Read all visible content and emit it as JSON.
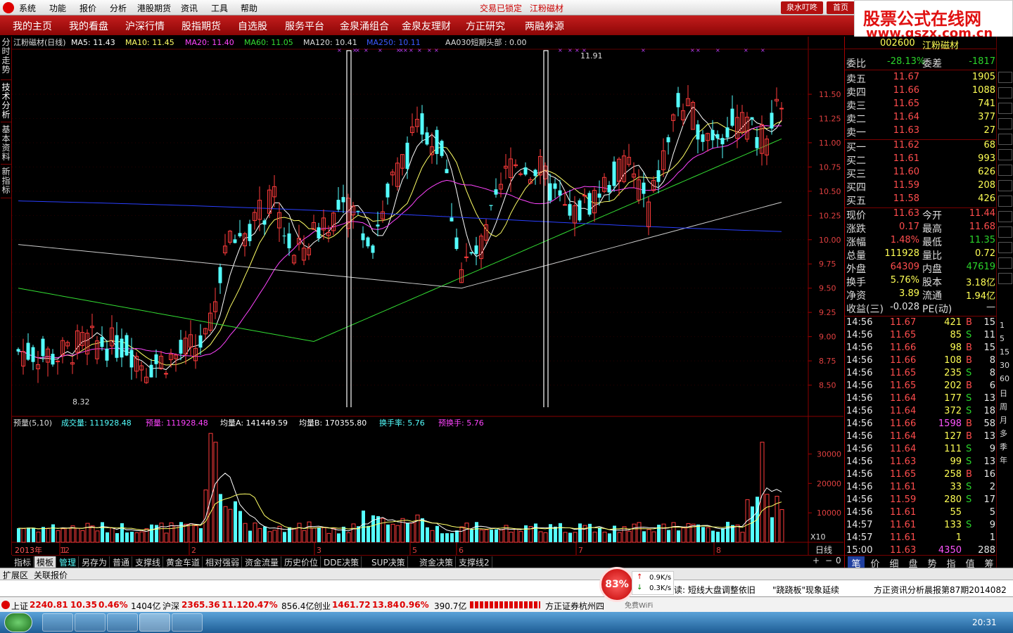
{
  "titlebar": {
    "menus": [
      "系统",
      "功能",
      "报价",
      "分析",
      "港股期货",
      "资讯",
      "工具",
      "帮助"
    ],
    "status": "交易已锁定",
    "stock_title": "江粉磁材",
    "btn1": "泉水叮咚",
    "btn2": "首页"
  },
  "banner": {
    "line1": "股票公式在线网",
    "line2": "www.gszx.com.cn"
  },
  "navbar": {
    "items": [
      "我的主页",
      "我的看盘",
      "沪深行情",
      "股指期货",
      "自选股",
      "服务平台",
      "金泉涌组合",
      "金泉友理财",
      "方正研究",
      "两融券源"
    ]
  },
  "left_tabs": [
    "分时走势",
    "技术分析",
    "基本资料",
    "新指标"
  ],
  "chart_header": {
    "name": "江粉磁材(日线)",
    "ma5": "MA5: 11.43",
    "ma10": "MA10: 11.45",
    "ma20": "MA20: 11.40",
    "ma60": "MA60: 11.05",
    "ma120": "MA120: 10.41",
    "ma250": "MA250: 10.11",
    "aa030": "AA030短期头部 : 0.00",
    "high_label": "11.91",
    "low_label": "8.32"
  },
  "price_axis": [
    "11.50",
    "11.25",
    "11.00",
    "10.75",
    "10.50",
    "10.25",
    "10.00",
    "9.75",
    "9.50",
    "9.25",
    "9.00",
    "8.75",
    "8.50"
  ],
  "vol_header": {
    "name": "预量(5,10)",
    "cjl": "成交量: 111928.48",
    "yl": "预量: 111928.48",
    "ja": "均量A: 141449.59",
    "jb": "均量B: 170355.80",
    "hsl": "换手率: 5.76",
    "yhs": "预换手: 5.76"
  },
  "vol_axis": [
    "30000",
    "20000",
    "10000"
  ],
  "vol_unit": "X10",
  "date_axis": {
    "year": "2013年",
    "labels": [
      "12",
      "1",
      "2",
      "3",
      "5",
      "6",
      "7",
      "8"
    ],
    "period": "日线"
  },
  "quote": {
    "code": "002600",
    "name": "江粉磁材",
    "weibi_label": "委比",
    "weibi": "-28.13%",
    "weicha_label": "委差",
    "weicha": "-1817",
    "sells": [
      {
        "label": "卖五",
        "price": "11.67",
        "vol": "1905"
      },
      {
        "label": "卖四",
        "price": "11.66",
        "vol": "1088"
      },
      {
        "label": "卖三",
        "price": "11.65",
        "vol": "741"
      },
      {
        "label": "卖二",
        "price": "11.64",
        "vol": "377"
      },
      {
        "label": "卖一",
        "price": "11.63",
        "vol": "27"
      }
    ],
    "buys": [
      {
        "label": "买一",
        "price": "11.62",
        "vol": "68"
      },
      {
        "label": "买二",
        "price": "11.61",
        "vol": "993"
      },
      {
        "label": "买三",
        "price": "11.60",
        "vol": "626"
      },
      {
        "label": "买四",
        "price": "11.59",
        "vol": "208"
      },
      {
        "label": "买五",
        "price": "11.58",
        "vol": "426"
      }
    ],
    "stats": [
      {
        "l1": "现价",
        "v1": "11.63",
        "l2": "今开",
        "v2": "11.44"
      },
      {
        "l1": "涨跌",
        "v1": "0.17",
        "l2": "最高",
        "v2": "11.68"
      },
      {
        "l1": "涨幅",
        "v1": "1.48%",
        "l2": "最低",
        "v2": "11.35"
      },
      {
        "l1": "总量",
        "v1": "111928",
        "l2": "量比",
        "v2": "0.72"
      },
      {
        "l1": "外盘",
        "v1": "64309",
        "l2": "内盘",
        "v2": "47619"
      },
      {
        "l1": "换手",
        "v1": "5.76%",
        "l2": "股本",
        "v2": "3.18亿"
      },
      {
        "l1": "净资",
        "v1": "3.89",
        "l2": "流通",
        "v2": "1.94亿"
      },
      {
        "l1": "收益(三)",
        "v1": "-0.028",
        "l2": "PE(动)",
        "v2": "—"
      }
    ],
    "ticks": [
      {
        "t": "14:56",
        "p": "11.67",
        "v": "421",
        "d": "B",
        "n": "15"
      },
      {
        "t": "14:56",
        "p": "11.65",
        "v": "85",
        "d": "S",
        "n": "11"
      },
      {
        "t": "14:56",
        "p": "11.66",
        "v": "98",
        "d": "B",
        "n": "15"
      },
      {
        "t": "14:56",
        "p": "11.66",
        "v": "108",
        "d": "B",
        "n": "8"
      },
      {
        "t": "14:56",
        "p": "11.65",
        "v": "235",
        "d": "S",
        "n": "8"
      },
      {
        "t": "14:56",
        "p": "11.65",
        "v": "202",
        "d": "B",
        "n": "6"
      },
      {
        "t": "14:56",
        "p": "11.64",
        "v": "177",
        "d": "S",
        "n": "13"
      },
      {
        "t": "14:56",
        "p": "11.64",
        "v": "372",
        "d": "S",
        "n": "18"
      },
      {
        "t": "14:56",
        "p": "11.66",
        "v": "1598",
        "d": "B",
        "n": "58"
      },
      {
        "t": "14:56",
        "p": "11.64",
        "v": "127",
        "d": "B",
        "n": "13"
      },
      {
        "t": "14:56",
        "p": "11.64",
        "v": "111",
        "d": "S",
        "n": "9"
      },
      {
        "t": "14:56",
        "p": "11.63",
        "v": "99",
        "d": "S",
        "n": "13"
      },
      {
        "t": "14:56",
        "p": "11.65",
        "v": "258",
        "d": "B",
        "n": "16"
      },
      {
        "t": "14:56",
        "p": "11.61",
        "v": "33",
        "d": "S",
        "n": "2"
      },
      {
        "t": "14:56",
        "p": "11.59",
        "v": "280",
        "d": "S",
        "n": "17"
      },
      {
        "t": "14:56",
        "p": "11.61",
        "v": "55",
        "d": "",
        "n": "5"
      },
      {
        "t": "14:57",
        "p": "11.61",
        "v": "133",
        "d": "S",
        "n": "9"
      },
      {
        "t": "14:57",
        "p": "11.61",
        "v": "1",
        "d": "",
        "n": "1"
      },
      {
        "t": "15:00",
        "p": "11.63",
        "v": "4350",
        "d": "",
        "n": "288"
      }
    ],
    "bottom_tabs": [
      "笔",
      "价",
      "细",
      "盘",
      "势",
      "指",
      "值",
      "筹"
    ]
  },
  "right_tools": [
    "1",
    "5",
    "15",
    "30",
    "60",
    "日",
    "周",
    "月",
    "多",
    "季",
    "年"
  ],
  "bottom_tabs": [
    "指标",
    "模板",
    "管理",
    "另存为",
    "普通",
    "支撑线",
    "黄金车道",
    "相对强弱",
    "资金流量",
    "历史价位",
    "DDE决策",
    "SUP决策",
    "资金决策",
    "支撑线2"
  ],
  "expand": {
    "a": "扩展区",
    "b": "关联报价"
  },
  "news": {
    "n1": "读:  短线大盘调整依旧",
    "n2": "\"跷跷板\"现象延续",
    "n3": "方正资讯分析晨报第87期2014082"
  },
  "speed": {
    "pct": "83%",
    "up": "0.9K/s",
    "down": "0.3K/s",
    "wifi": "免费WiFi"
  },
  "index": {
    "sh_name": "上证",
    "sh_val": "2240.81",
    "sh_chg": "10.35",
    "sh_pct": "0.46%",
    "sh_amt": "1404亿",
    "hs_name": "沪深",
    "hs_val": "2365.36",
    "hs_chg": "11.12",
    "hs_pct": "0.47%",
    "hs_amt": "856.4亿",
    "cy_name": "创业",
    "cy_val": "1461.72",
    "cy_chg": "13.84",
    "cy_pct": "0.96%",
    "cy_amt": "390.7亿",
    "broker": "方正证券杭州四"
  },
  "clock": "20:31",
  "colors": {
    "up": "#ff3b3b",
    "down": "#54ffff",
    "ma5": "#ffffff",
    "ma10": "#ffff66",
    "ma20": "#ff44ff",
    "ma60": "#33dd33",
    "ma120": "#cccccc",
    "ma250": "#2a3fff"
  }
}
